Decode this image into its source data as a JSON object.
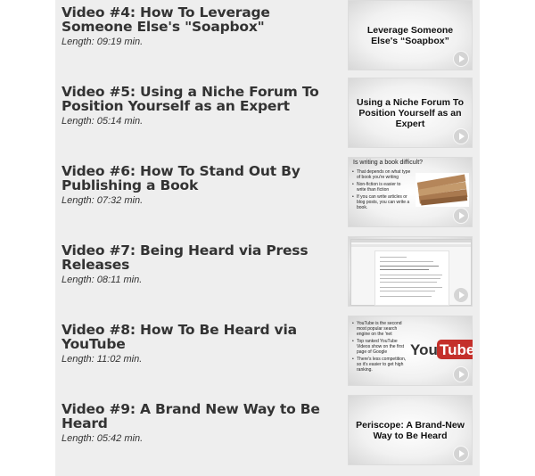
{
  "videos": [
    {
      "title": "Video #4: How To Leverage Someone Else's \"Soapbox\"",
      "length": "Length: 09:19 min.",
      "thumb": {
        "kind": "caption",
        "caption": "Leverage Someone Else's “Soapbox”"
      }
    },
    {
      "title": "Video #5: Using a Niche Forum To Position Yourself as an Expert",
      "length": "Length: 05:14 min.",
      "thumb": {
        "kind": "caption",
        "caption": "Using a Niche Forum To Position Yourself as an Expert"
      }
    },
    {
      "title": "Video #6: How To Stand Out By Publishing a Book",
      "length": "Length: 07:32 min.",
      "thumb": {
        "kind": "bullets",
        "heading": "Is writing a book difficult?",
        "bullets": [
          "That depends on what type of book you're writing",
          "Non-fiction is easier to write than fiction",
          "If you can write articles or blog posts, you can write a book."
        ]
      }
    },
    {
      "title": "Video #7: Being Heard via Press Releases",
      "length": "Length: 08:11 min.",
      "thumb": {
        "kind": "screenshot"
      }
    },
    {
      "title": "Video #8: How To Be Heard via YouTube",
      "length": "Length: 11:02 min.",
      "thumb": {
        "kind": "youtube",
        "bullets": [
          "YouTube is the second most popular search engine on the 'net",
          "Top ranked YouTube Videos show on the first page of Google",
          "There's less competition, so it's easier to get high ranking."
        ],
        "logo_you": "You",
        "logo_tube": "Tube"
      }
    },
    {
      "title": "Video #9: A Brand New Way to Be Heard",
      "length": "Length: 05:42 min.",
      "thumb": {
        "kind": "caption",
        "caption": "Periscope: A Brand-New Way to Be Heard"
      }
    }
  ],
  "colors": {
    "panel": "#eeeeee",
    "text": "#333333",
    "youtube_red": "#c4302b"
  }
}
